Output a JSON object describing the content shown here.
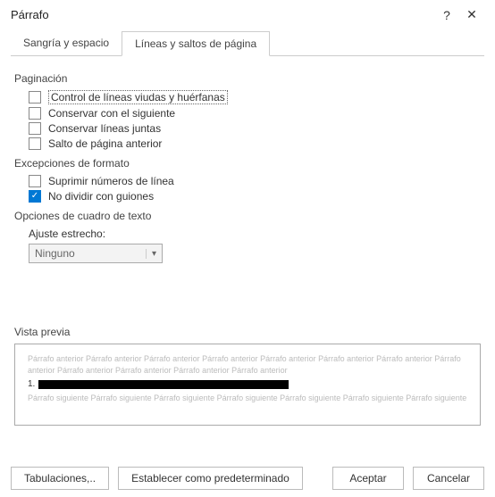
{
  "titlebar": {
    "title": "Párrafo",
    "help": "?",
    "close": "✕"
  },
  "tabs": {
    "indent": "Sangría y espacio",
    "lines": "Líneas y saltos de página"
  },
  "pagination": {
    "label": "Paginación",
    "widow": "Control de líneas viudas y huérfanas",
    "keepnext": "Conservar con el siguiente",
    "keeplines": "Conservar líneas juntas",
    "pagebreak": "Salto de página anterior"
  },
  "formatting": {
    "label": "Excepciones de formato",
    "suppress": "Suprimir números de línea",
    "nohyphen": "No dividir con guiones"
  },
  "textbox": {
    "label": "Opciones de cuadro de texto",
    "tightwrap": "Ajuste estrecho:",
    "selected": "Ninguno"
  },
  "preview": {
    "label": "Vista previa",
    "before": "Párrafo anterior Párrafo anterior Párrafo anterior Párrafo anterior Párrafo anterior Párrafo anterior Párrafo anterior Párrafo anterior Párrafo anterior Párrafo anterior Párrafo anterior Párrafo anterior",
    "num": "1.",
    "after": "Párrafo siguiente Párrafo siguiente Párrafo siguiente Párrafo siguiente Párrafo siguiente Párrafo siguiente Párrafo siguiente"
  },
  "footer": {
    "tabs": "Tabulaciones,..",
    "default": "Establecer como predeterminado",
    "ok": "Aceptar",
    "cancel": "Cancelar"
  }
}
